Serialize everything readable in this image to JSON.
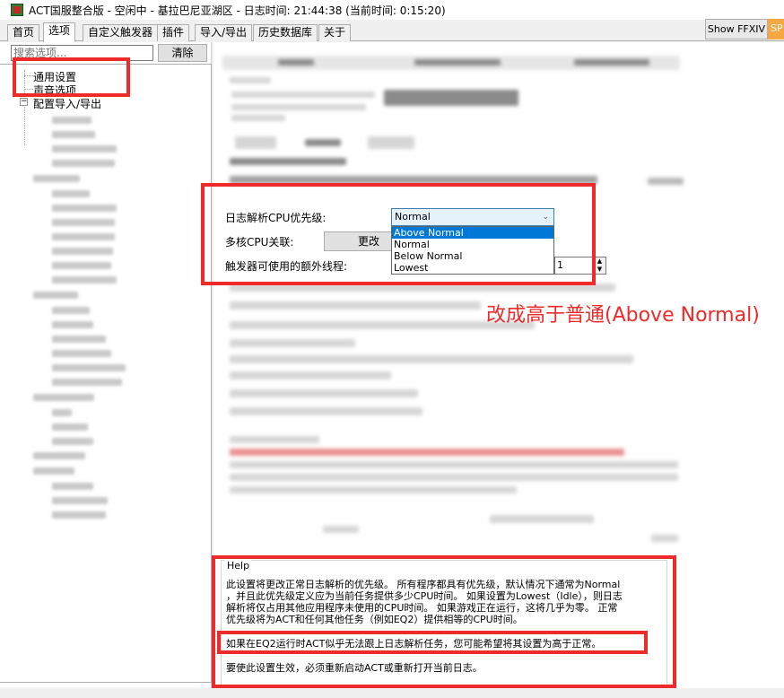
{
  "window": {
    "title": "ACT国服整合版 - 空闲中 - 基拉巴尼亚湖区 - 日志时间: 21:44:38 (当前时间: 0:15:20)"
  },
  "tabs": [
    "首页",
    "选项",
    "自定义触发器",
    "插件",
    "导入/导出",
    "历史数据库",
    "关于"
  ],
  "toolbar": {
    "ffxiv_label": "Show FFXIV",
    "sp_label": "SP"
  },
  "sidebar": {
    "search_placeholder": "搜索选项...",
    "clear_label": "清除",
    "tree": {
      "item0": "通用设置",
      "item1": "声音选项",
      "item2": "配置导入/导出"
    }
  },
  "settings": {
    "cpu_priority_label": "日志解析CPU优先级:",
    "cpu_priority_value": "Normal",
    "cpu_priority_options": [
      "Above Normal",
      "Normal",
      "Below Normal",
      "Lowest"
    ],
    "multicore_label": "多核CPU关联:",
    "change_label": "更改",
    "threads_label": "触发器可使用的额外线程:",
    "threads_value": "1",
    "blurred_line": "打开或关闭日志文件时，如果前一项目（以及系统闲置）则要立刻重命名日"
  },
  "annotation": "改成高于普通(Above Normal)",
  "help": {
    "legend": "Help",
    "p1_line1": "此设置将更改正常日志解析的优先级。 所有程序都具有优先级，默认情况下通常为Normal",
    "p1_line2": "，并且此优先级定义应为当前任务提供多少CPU时间。 如果设置为Lowest（Idle），则日志",
    "p1_line3": "解析将仅占用其他应用程序未使用的CPU时间。 如果游戏正在运行，这将几乎为零。 正常",
    "p1_line4": "优先级将为ACT和任何其他任务（例如EQ2）提供相等的CPU时间。",
    "p2": "如果在EQ2运行时ACT似乎无法跟上日志解析任务，您可能希望将其设置为高于正常。",
    "p3": "要使此设置生效，必须重新启动ACT或重新打开当前日志。"
  },
  "colors": {
    "highlight_red": "#ee2a2a",
    "select_blue": "#0078d7"
  }
}
